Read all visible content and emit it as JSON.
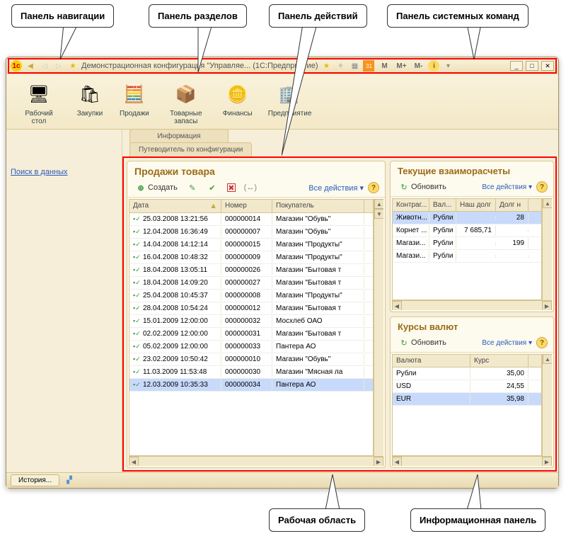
{
  "callouts": {
    "nav": "Панель навигации",
    "sections": "Панель разделов",
    "actions": "Панель действий",
    "syscmd": "Панель системных команд",
    "workarea": "Рабочая область",
    "infopanel": "Информационная панель"
  },
  "titlebar": {
    "title": "Демонстрационная конфигурация \"Управляе... (1С:Предприятие)",
    "mem": [
      "M",
      "M+",
      "M-"
    ]
  },
  "sections": [
    {
      "label": "Рабочий стол",
      "glyph": "🖥"
    },
    {
      "label": "Закупки",
      "glyph": "🛍"
    },
    {
      "label": "Продажи",
      "glyph": "🧮"
    },
    {
      "label": "Товарные запасы",
      "glyph": "📦"
    },
    {
      "label": "Финансы",
      "glyph": "🪙"
    },
    {
      "label": "Предприятие",
      "glyph": "🏢"
    }
  ],
  "nav": {
    "search": "Поиск в данных"
  },
  "actions": {
    "tab1": "Информация",
    "tab2": "Путеводитель по конфигурации"
  },
  "sales": {
    "title": "Продажи товара",
    "create": "Создать",
    "all_actions": "Все действия ▾",
    "cols": [
      "Дата",
      "Номер",
      "Покупатель"
    ],
    "rows": [
      {
        "date": "25.03.2008 13:21:56",
        "num": "000000014",
        "buyer": "Магазин \"Обувь\""
      },
      {
        "date": "12.04.2008 16:36:49",
        "num": "000000007",
        "buyer": "Магазин \"Обувь\""
      },
      {
        "date": "14.04.2008 14:12:14",
        "num": "000000015",
        "buyer": "Магазин \"Продукты\""
      },
      {
        "date": "16.04.2008 10:48:32",
        "num": "000000009",
        "buyer": "Магазин \"Продукты\""
      },
      {
        "date": "18.04.2008 13:05:11",
        "num": "000000026",
        "buyer": "Магазин \"Бытовая т"
      },
      {
        "date": "18.04.2008 14:09:20",
        "num": "000000027",
        "buyer": "Магазин \"Бытовая т"
      },
      {
        "date": "25.04.2008 10:45:37",
        "num": "000000008",
        "buyer": "Магазин \"Продукты\""
      },
      {
        "date": "28.04.2008 10:54:24",
        "num": "000000012",
        "buyer": "Магазин \"Бытовая т"
      },
      {
        "date": "15.01.2009 12:00:00",
        "num": "000000032",
        "buyer": "Мосхлеб ОАО"
      },
      {
        "date": "02.02.2009 12:00:00",
        "num": "000000031",
        "buyer": "Магазин \"Бытовая т"
      },
      {
        "date": "05.02.2009 12:00:00",
        "num": "000000033",
        "buyer": "Пантера АО"
      },
      {
        "date": "23.02.2009 10:50:42",
        "num": "000000010",
        "buyer": "Магазин \"Обувь\""
      },
      {
        "date": "11.03.2009 11:53:48",
        "num": "000000030",
        "buyer": "Магазин \"Мясная ла"
      },
      {
        "date": "12.03.2009 10:35:33",
        "num": "000000034",
        "buyer": "Пантера АО",
        "sel": true
      }
    ]
  },
  "settlements": {
    "title": "Текущие взаиморасчеты",
    "refresh": "Обновить",
    "all_actions": "Все действия ▾",
    "cols": [
      "Контраг...",
      "Вал...",
      "Наш долг",
      "Долг н"
    ],
    "rows": [
      {
        "c": "Животн...",
        "v": "Рубли",
        "d1": "",
        "d2": "28",
        "sel": true
      },
      {
        "c": "Корнет ...",
        "v": "Рубли",
        "d1": "7 685,71",
        "d2": ""
      },
      {
        "c": "Магази...",
        "v": "Рубли",
        "d1": "",
        "d2": "199"
      },
      {
        "c": "Магази...",
        "v": "Рубли",
        "d1": "",
        "d2": ""
      }
    ]
  },
  "rates": {
    "title": "Курсы валют",
    "refresh": "Обновить",
    "all_actions": "Все действия ▾",
    "cols": [
      "Валюта",
      "Курс"
    ],
    "rows": [
      {
        "c": "Рубли",
        "r": "35,00"
      },
      {
        "c": "USD",
        "r": "24,55"
      },
      {
        "c": "EUR",
        "r": "35,98",
        "sel": true
      }
    ]
  },
  "status": {
    "history": "История..."
  }
}
